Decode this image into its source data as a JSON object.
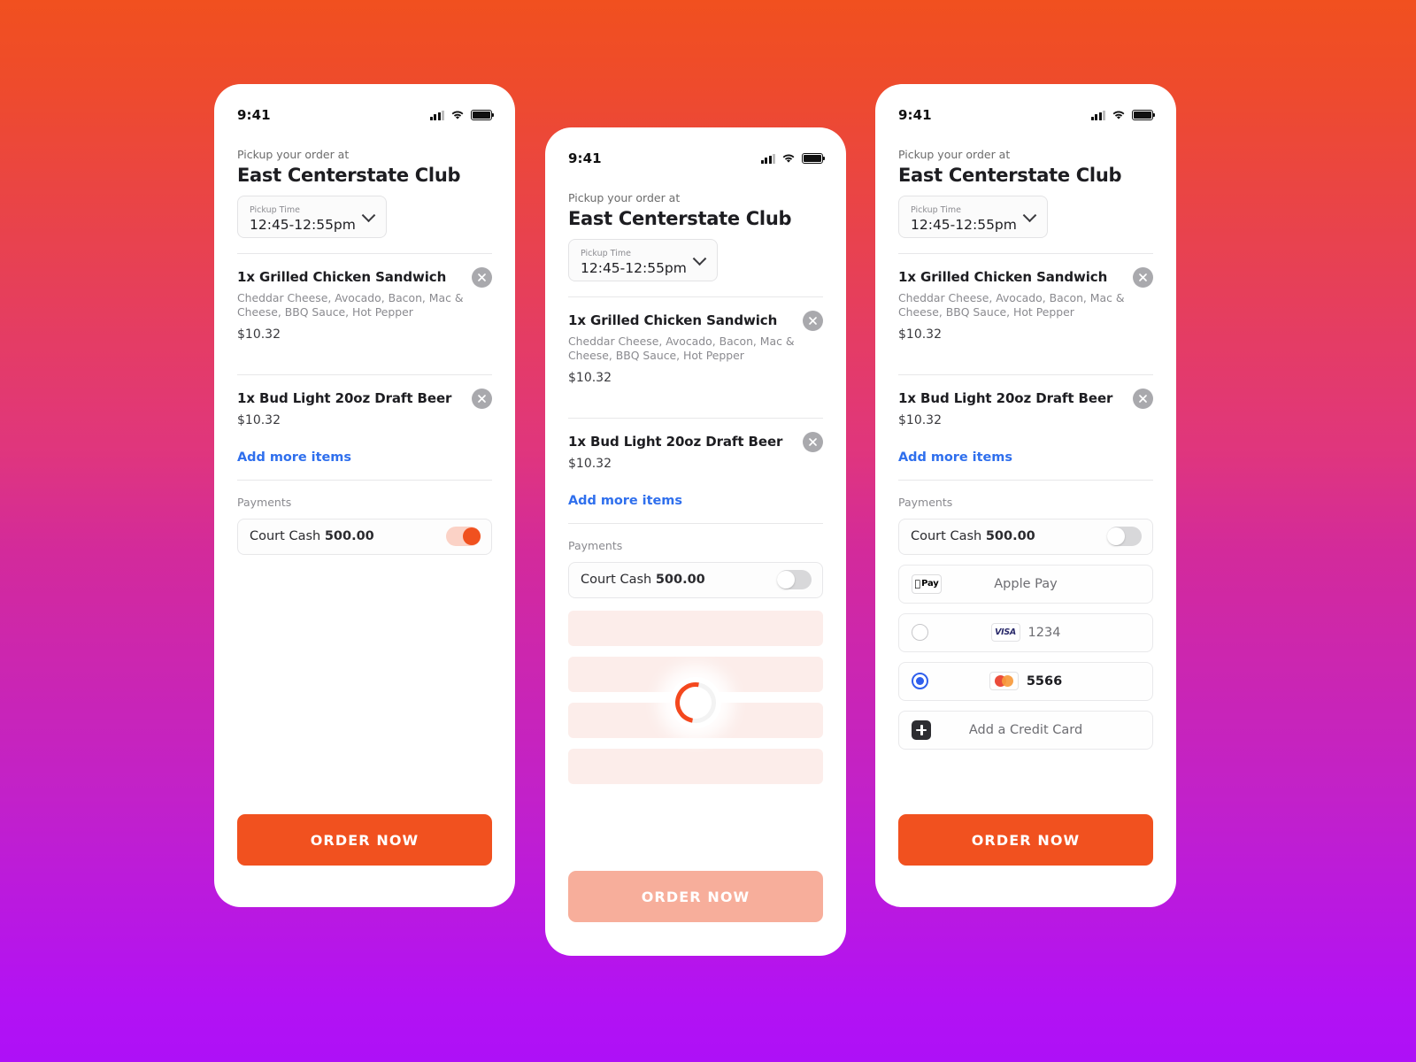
{
  "background": {
    "gradient_from": "#F1501F",
    "gradient_mid": "#D32A9B",
    "gradient_to": "#AE10F7"
  },
  "colors": {
    "accent_orange": "#F1511F",
    "accent_orange_disabled": "#F7AE9B",
    "link_blue": "#2F6FED",
    "radio_blue": "#2F5FED",
    "skeleton": "#FCEDEA"
  },
  "status_bar": {
    "time": "9:41",
    "cellular_icon": "signal-bars-icon",
    "wifi_icon": "wifi-icon",
    "battery_icon": "battery-full-icon"
  },
  "header": {
    "eyebrow": "Pickup your order at",
    "venue": "East Centerstate Club",
    "pickup_time": {
      "label": "Pickup Time",
      "value": "12:45-12:55pm",
      "chevron_icon": "chevron-down-icon"
    }
  },
  "order": {
    "items": [
      {
        "title": "1x Grilled Chicken Sandwich",
        "description": "Cheddar Cheese, Avocado, Bacon, Mac & Cheese, BBQ Sauce, Hot Pepper",
        "price": "$10.32",
        "remove_icon": "close-circle-icon"
      },
      {
        "title": "1x Bud Light 20oz Draft Beer",
        "description": "",
        "price": "$10.32",
        "remove_icon": "close-circle-icon"
      }
    ],
    "add_more_label": "Add more items"
  },
  "payments": {
    "section_label": "Payments",
    "court_cash": {
      "label": "Court Cash ",
      "amount": "500.00",
      "toggle_on_left": true,
      "toggle_off_right": false
    },
    "methods": [
      {
        "name": "apple-pay",
        "badge": "applepay-badge-icon",
        "badge_apple": "",
        "badge_text": "Pay",
        "label": "Apple Pay",
        "selector": "none"
      },
      {
        "name": "visa-1234",
        "badge": "visa-logo-icon",
        "badge_text": "VISA",
        "label": "1234",
        "selector": "radio-unchecked"
      },
      {
        "name": "mastercard-5566",
        "badge": "mastercard-logo-icon",
        "badge_text": "",
        "label": "5566",
        "selector": "radio-checked"
      },
      {
        "name": "add-credit-card",
        "badge": "plus-square-icon",
        "badge_text": "",
        "label": "Add a Credit Card",
        "selector": "none"
      }
    ]
  },
  "loading": {
    "spinner_icon": "loading-spinner-icon",
    "skeleton_rows": 4
  },
  "cta": {
    "label": "ORDER NOW"
  }
}
